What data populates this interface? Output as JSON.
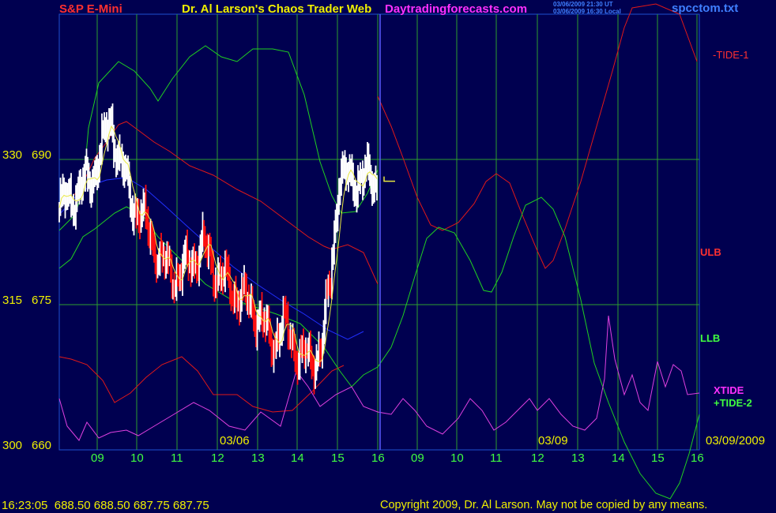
{
  "header": {
    "instrument": "S&P E-Mini",
    "title": "Dr. Al Larson's Chaos Trader Web",
    "site": "Daytradingforecasts.com",
    "stamp1": "03/06/2009 21:30 UT",
    "stamp2": "03/06/2009 16:30 Local",
    "file": "spcctom.txt"
  },
  "colors": {
    "background": "#000050",
    "grid": "#2e9e2e",
    "text_yellow": "#f0f000",
    "text_red": "#ff3030",
    "text_green": "#40ff40",
    "text_magenta": "#ff30ff",
    "text_blue": "#3f7fff",
    "price_up": "#ffffff",
    "price_down": "#ff1010",
    "tide1": "#e01818",
    "tide2": "#20d020",
    "xtide": "#e040e0",
    "ma_yellow": "#e8e840",
    "ma_blue": "#2030ff"
  },
  "legend": {
    "tide1": "-TIDE-1",
    "ulb": "ULB",
    "llb": "LLB",
    "xtide": "XTIDE",
    "tide2": "+TIDE-2"
  },
  "footer": {
    "quote": "16:23:05  688.50 688.50 687.75 687.75",
    "copyright": "Copyright 2009, Dr. Al Larson. May not be copied by any means."
  },
  "chart_data": {
    "type": "line",
    "y_axes": {
      "left_outer": {
        "ticks": [
          "330",
          "315",
          "300"
        ],
        "values": [
          330,
          315,
          300
        ]
      },
      "left_inner": {
        "ticks": [
          "690",
          "675",
          "660"
        ],
        "values": [
          690,
          675,
          660
        ]
      }
    },
    "ylim": [
      660,
      696
    ],
    "x_ticks": [
      "09",
      "10",
      "11",
      "12",
      "13",
      "14",
      "15",
      "16",
      "09",
      "10",
      "11",
      "12",
      "13",
      "14",
      "15",
      "16"
    ],
    "date_labels": [
      "03/06",
      "03/09",
      "03/09/2009"
    ],
    "now_marker": "16",
    "last_close": 687.75,
    "series": [
      {
        "key": "price",
        "values_hourly": [
          [
            0,
            685
          ],
          [
            0.8,
            688
          ],
          [
            1.3,
            694
          ],
          [
            1.5,
            690
          ],
          [
            1.8,
            686
          ],
          [
            2.2,
            683
          ],
          [
            2.6,
            679
          ],
          [
            3.0,
            678
          ],
          [
            3.6,
            681
          ],
          [
            4.0,
            678
          ],
          [
            4.5,
            676
          ],
          [
            5.0,
            674
          ],
          [
            5.3,
            671
          ],
          [
            5.6,
            673
          ],
          [
            6.0,
            670
          ],
          [
            6.3,
            669
          ],
          [
            6.6,
            671
          ],
          [
            6.8,
            678
          ],
          [
            7.0,
            688
          ]
        ]
      },
      {
        "key": "tide1",
        "name": "-TIDE-1"
      },
      {
        "key": "tide2",
        "name": "+TIDE-2"
      },
      {
        "key": "xtide",
        "name": "XTIDE"
      },
      {
        "key": "ulb",
        "name": "ULB"
      },
      {
        "key": "llb",
        "name": "LLB"
      }
    ]
  }
}
